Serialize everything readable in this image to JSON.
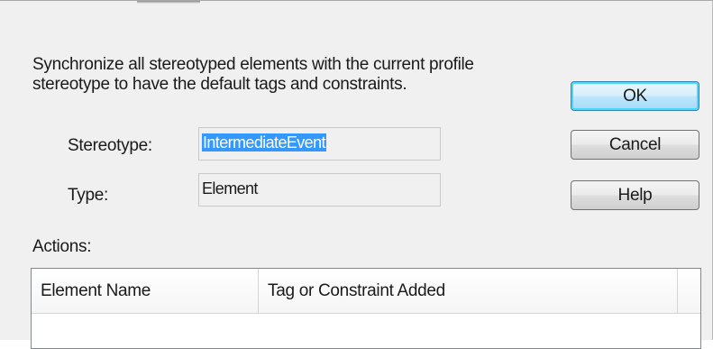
{
  "dialog": {
    "description_lines": [
      "Synchronize all stereotyped elements with the current profile",
      "stereotype to have the default tags and constraints."
    ],
    "stereotype": {
      "label": "Stereotype:",
      "value": "IntermediateEvent"
    },
    "type": {
      "label": "Type:",
      "value": "Element"
    },
    "actions_label": "Actions:",
    "buttons": {
      "ok": "OK",
      "cancel": "Cancel",
      "help": "Help"
    },
    "actions_list": {
      "columns": [
        "Element Name",
        "Tag or Constraint Added"
      ],
      "rows": []
    }
  },
  "colors": {
    "dialog_bg": "#f0f0f0",
    "selection": "#3399ff",
    "default_button_border": "#3c7fb1"
  }
}
